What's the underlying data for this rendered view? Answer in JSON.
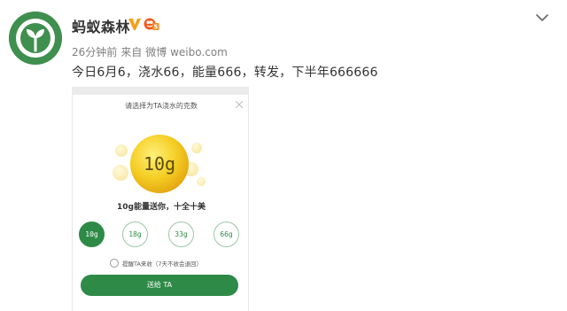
{
  "post": {
    "username": "蚂蚁森林",
    "time": "26分钟前",
    "source_prefix": "来自",
    "source": "微博 weibo.com",
    "text": "今日6月6，浇水66，能量666，转发，下半年666666"
  },
  "badges": {
    "verified_icon": "verified-v-icon",
    "level_icon": "vip-level-icon",
    "level_text": "5"
  },
  "dialog": {
    "title": "请选择为TA浇水的克数",
    "coin_label": "10g",
    "message": "10g能量送你，十全十美",
    "options": [
      "10g",
      "18g",
      "33g",
      "66g"
    ],
    "selected_option": "10g",
    "remind_label": "提醒TA来收（7天不收会退回）",
    "send_label": "送给 TA"
  },
  "colors": {
    "brand_green": "#2e8a47",
    "avatar_green": "#3f8f4e",
    "verified_orange": "#f3a11b",
    "coin_yellow": "#f2c118"
  }
}
